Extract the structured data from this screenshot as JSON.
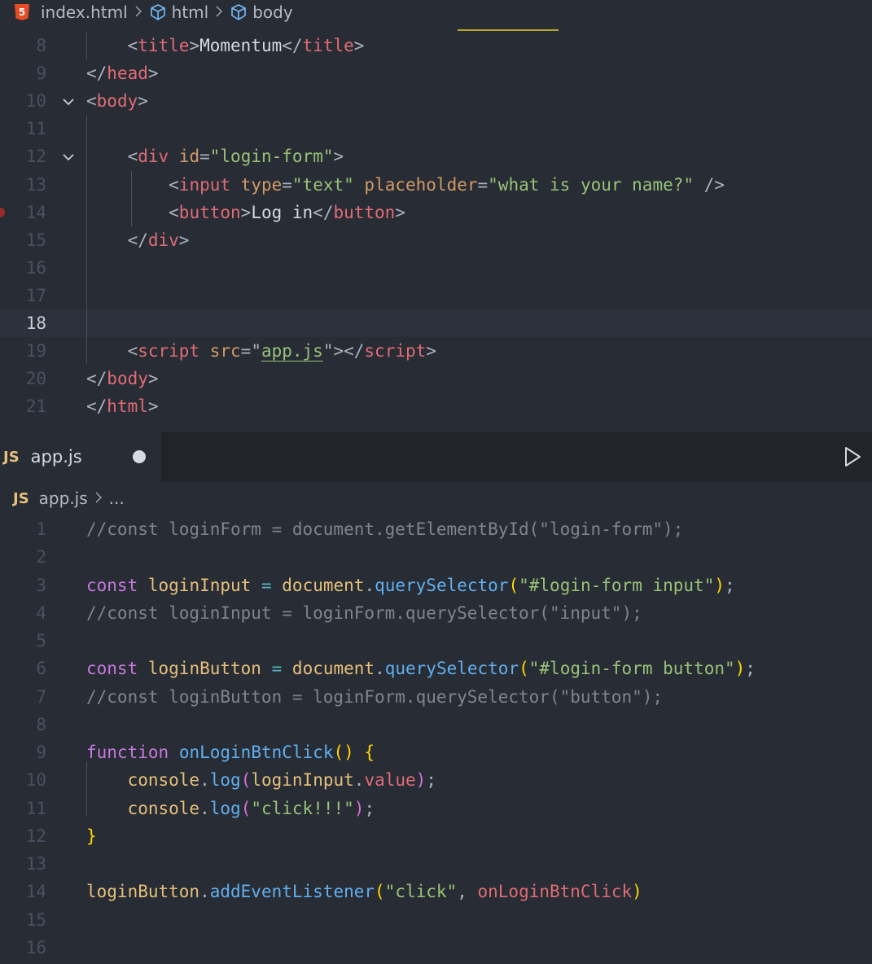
{
  "top_editor": {
    "breadcrumb": {
      "file": "index.html",
      "html_badge": "5",
      "path": [
        "html",
        "body"
      ]
    },
    "lines": [
      {
        "num": "8",
        "tokens": [
          [
            "t-punc",
            "    <"
          ],
          [
            "t-tag",
            "title"
          ],
          [
            "t-punc",
            ">"
          ],
          [
            "t-text",
            "Momentum"
          ],
          [
            "t-punc",
            "</"
          ],
          [
            "t-tag",
            "title"
          ],
          [
            "t-punc",
            ">"
          ]
        ]
      },
      {
        "num": "9",
        "tokens": [
          [
            "t-punc",
            "</"
          ],
          [
            "t-tag",
            "head"
          ],
          [
            "t-punc",
            ">"
          ]
        ]
      },
      {
        "num": "10",
        "tokens": [
          [
            "t-punc",
            "<"
          ],
          [
            "t-tag",
            "body"
          ],
          [
            "t-punc",
            ">"
          ]
        ]
      },
      {
        "num": "11",
        "tokens": []
      },
      {
        "num": "12",
        "tokens": [
          [
            "t-punc",
            "    <"
          ],
          [
            "t-tag",
            "div"
          ],
          [
            "t-punc",
            " "
          ],
          [
            "t-attr",
            "id"
          ],
          [
            "t-punc",
            "="
          ],
          [
            "t-str",
            "\"login-form\""
          ],
          [
            "t-punc",
            ">"
          ]
        ]
      },
      {
        "num": "13",
        "tokens": [
          [
            "t-punc",
            "        <"
          ],
          [
            "t-tag",
            "input"
          ],
          [
            "t-punc",
            " "
          ],
          [
            "t-attr",
            "type"
          ],
          [
            "t-punc",
            "="
          ],
          [
            "t-str",
            "\"text\""
          ],
          [
            "t-punc",
            " "
          ],
          [
            "t-attr",
            "placeholder"
          ],
          [
            "t-punc",
            "="
          ],
          [
            "t-str",
            "\"what is your name?\""
          ],
          [
            "t-punc",
            " />"
          ]
        ]
      },
      {
        "num": "14",
        "tokens": [
          [
            "t-punc",
            "        <"
          ],
          [
            "t-tag",
            "button"
          ],
          [
            "t-punc",
            ">"
          ],
          [
            "t-text",
            "Log in"
          ],
          [
            "t-punc",
            "</"
          ],
          [
            "t-tag",
            "button"
          ],
          [
            "t-punc",
            ">"
          ]
        ]
      },
      {
        "num": "15",
        "tokens": [
          [
            "t-punc",
            "    </"
          ],
          [
            "t-tag",
            "div"
          ],
          [
            "t-punc",
            ">"
          ]
        ]
      },
      {
        "num": "16",
        "tokens": []
      },
      {
        "num": "17",
        "tokens": []
      },
      {
        "num": "18",
        "tokens": []
      },
      {
        "num": "19",
        "tokens": [
          [
            "t-punc",
            "    <"
          ],
          [
            "t-tag",
            "script"
          ],
          [
            "t-punc",
            " "
          ],
          [
            "t-attr",
            "src"
          ],
          [
            "t-punc",
            "=\""
          ],
          [
            "t-str squig",
            "app.js"
          ],
          [
            "t-punc",
            "\"></"
          ],
          [
            "t-tag",
            "script"
          ],
          [
            "t-punc",
            ">"
          ]
        ]
      },
      {
        "num": "20",
        "tokens": [
          [
            "t-punc",
            "</"
          ],
          [
            "t-tag",
            "body"
          ],
          [
            "t-punc",
            ">"
          ]
        ]
      },
      {
        "num": "21",
        "tokens": [
          [
            "t-punc",
            "</"
          ],
          [
            "t-tag",
            "html"
          ],
          [
            "t-punc",
            ">"
          ]
        ]
      }
    ]
  },
  "bottom_editor": {
    "tab": {
      "badge": "JS",
      "label": "app.js"
    },
    "breadcrumb": {
      "badge": "JS",
      "file": "app.js",
      "more": "..."
    },
    "lines": [
      {
        "num": "1",
        "tokens": [
          [
            "t-cmt",
            "//const loginForm = document.getElementById(\"login-form\");"
          ]
        ]
      },
      {
        "num": "2",
        "tokens": []
      },
      {
        "num": "3",
        "tokens": [
          [
            "t-kw",
            "const"
          ],
          [
            "t-punc",
            " "
          ],
          [
            "t-var",
            "loginInput"
          ],
          [
            "t-punc",
            " "
          ],
          [
            "t-op",
            "="
          ],
          [
            "t-punc",
            " "
          ],
          [
            "t-var",
            "document"
          ],
          [
            "t-punc",
            "."
          ],
          [
            "t-fn",
            "querySelector"
          ],
          [
            "t-br1",
            "("
          ],
          [
            "t-str",
            "\"#login-form input\""
          ],
          [
            "t-br1",
            ")"
          ],
          [
            "t-punc",
            ";"
          ]
        ]
      },
      {
        "num": "4",
        "tokens": [
          [
            "t-cmt",
            "//const loginInput = loginForm.querySelector(\"input\");"
          ]
        ]
      },
      {
        "num": "5",
        "tokens": []
      },
      {
        "num": "6",
        "tokens": [
          [
            "t-kw",
            "const"
          ],
          [
            "t-punc",
            " "
          ],
          [
            "t-var",
            "loginButton"
          ],
          [
            "t-punc",
            " "
          ],
          [
            "t-op",
            "="
          ],
          [
            "t-punc",
            " "
          ],
          [
            "t-var",
            "document"
          ],
          [
            "t-punc",
            "."
          ],
          [
            "t-fn",
            "querySelector"
          ],
          [
            "t-br1",
            "("
          ],
          [
            "t-str",
            "\"#login-form button\""
          ],
          [
            "t-br1",
            ")"
          ],
          [
            "t-punc",
            ";"
          ]
        ]
      },
      {
        "num": "7",
        "tokens": [
          [
            "t-cmt",
            "//const loginButton = loginForm.querySelector(\"button\");"
          ]
        ]
      },
      {
        "num": "8",
        "tokens": []
      },
      {
        "num": "9",
        "tokens": [
          [
            "t-kw",
            "function"
          ],
          [
            "t-punc",
            " "
          ],
          [
            "t-fn",
            "onLoginBtnClick"
          ],
          [
            "t-br1",
            "()"
          ],
          [
            "t-punc",
            " "
          ],
          [
            "t-br1",
            "{"
          ]
        ]
      },
      {
        "num": "10",
        "tokens": [
          [
            "t-punc",
            "    "
          ],
          [
            "t-var",
            "console"
          ],
          [
            "t-punc",
            "."
          ],
          [
            "t-fn",
            "log"
          ],
          [
            "t-br2",
            "("
          ],
          [
            "t-var",
            "loginInput"
          ],
          [
            "t-punc",
            "."
          ],
          [
            "t-prop",
            "value"
          ],
          [
            "t-br2",
            ")"
          ],
          [
            "t-punc",
            ";"
          ]
        ]
      },
      {
        "num": "11",
        "tokens": [
          [
            "t-punc",
            "    "
          ],
          [
            "t-var",
            "console"
          ],
          [
            "t-punc",
            "."
          ],
          [
            "t-fn",
            "log"
          ],
          [
            "t-br2",
            "("
          ],
          [
            "t-str",
            "\"click!!!\""
          ],
          [
            "t-br2",
            ")"
          ],
          [
            "t-punc",
            ";"
          ]
        ]
      },
      {
        "num": "12",
        "tokens": [
          [
            "t-br1",
            "}"
          ]
        ]
      },
      {
        "num": "13",
        "tokens": []
      },
      {
        "num": "14",
        "tokens": [
          [
            "t-var",
            "loginButton"
          ],
          [
            "t-punc",
            "."
          ],
          [
            "t-fn",
            "addEventListener"
          ],
          [
            "t-br1",
            "("
          ],
          [
            "t-str",
            "\"click\""
          ],
          [
            "t-punc",
            ", "
          ],
          [
            "t-prop",
            "onLoginBtnClick"
          ],
          [
            "t-br1",
            ")"
          ]
        ]
      },
      {
        "num": "15",
        "tokens": []
      },
      {
        "num": "16",
        "tokens": []
      }
    ]
  }
}
